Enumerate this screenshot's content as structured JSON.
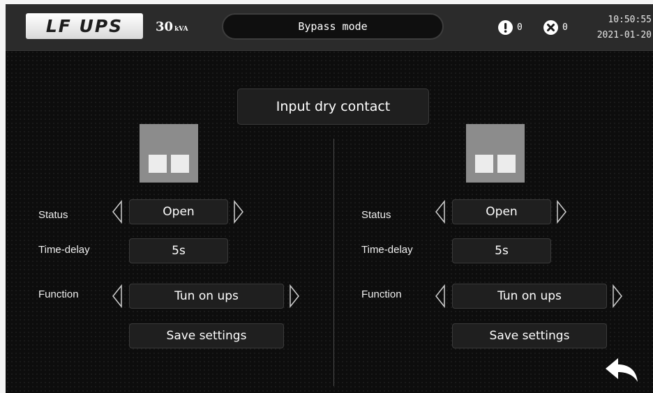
{
  "header": {
    "logo_text": "LF UPS",
    "capacity_value": "30",
    "capacity_unit": "kVA",
    "mode": "Bypass mode",
    "warning_count": "0",
    "fault_count": "0",
    "time": "10:50:55",
    "date": "2021-01-20"
  },
  "page": {
    "title": "Input dry contact"
  },
  "contacts": [
    {
      "status_label": "Status",
      "status_value": "Open",
      "delay_label": "Time-delay",
      "delay_value": "5s",
      "function_label": "Function",
      "function_value": "Tun on ups",
      "save_label": "Save settings"
    },
    {
      "status_label": "Status",
      "status_value": "Open",
      "delay_label": "Time-delay",
      "delay_value": "5s",
      "function_label": "Function",
      "function_value": "Tun on ups",
      "save_label": "Save settings"
    }
  ],
  "icons": {
    "warning": "exclamation-circle-icon",
    "fault": "x-circle-icon",
    "back": "return-arrow-icon",
    "prev": "left-triangle-icon",
    "next": "right-triangle-icon"
  },
  "colors": {
    "background": "#0d0d0d",
    "topbar": "#2b2b2b",
    "button": "#1f1f1f",
    "contact_icon": "#8c8c8c"
  }
}
